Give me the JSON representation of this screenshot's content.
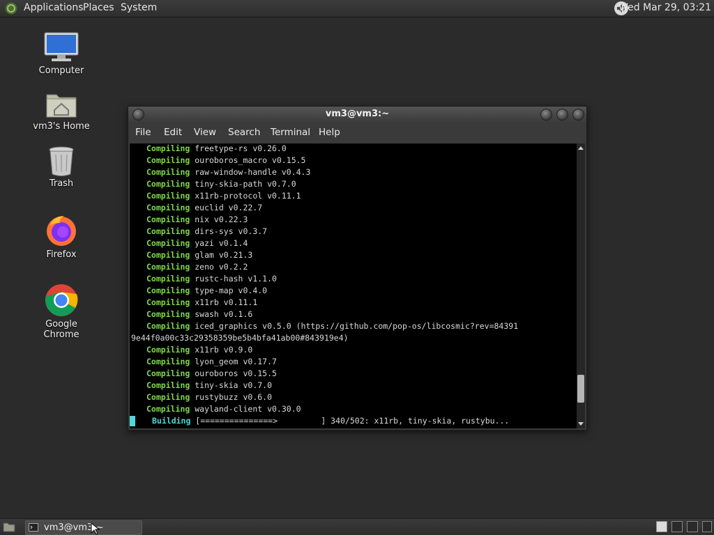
{
  "top_panel": {
    "menus": [
      "Applications",
      "Places",
      "System"
    ],
    "clock": "Wed Mar 29, 03:21",
    "icons": [
      "mate-menu-icon",
      "volume-icon"
    ]
  },
  "desktop": {
    "icons": [
      {
        "label": "Computer",
        "icon": "computer-icon"
      },
      {
        "label": "vm3's Home",
        "icon": "home-folder-icon"
      },
      {
        "label": "Trash",
        "icon": "trash-icon"
      },
      {
        "label": "Firefox",
        "icon": "firefox-icon"
      },
      {
        "label": "Google Chrome",
        "icon": "chrome-icon"
      }
    ]
  },
  "terminal": {
    "title": "vm3@vm3:~",
    "menu": [
      "File",
      "Edit",
      "View",
      "Search",
      "Terminal",
      "Help"
    ],
    "lines": [
      {
        "kw": "Compiling",
        "text": " freetype-rs v0.26.0"
      },
      {
        "kw": "Compiling",
        "text": " ouroboros_macro v0.15.5"
      },
      {
        "kw": "Compiling",
        "text": " raw-window-handle v0.4.3"
      },
      {
        "kw": "Compiling",
        "text": " tiny-skia-path v0.7.0"
      },
      {
        "kw": "Compiling",
        "text": " x11rb-protocol v0.11.1"
      },
      {
        "kw": "Compiling",
        "text": " euclid v0.22.7"
      },
      {
        "kw": "Compiling",
        "text": " nix v0.22.3"
      },
      {
        "kw": "Compiling",
        "text": " dirs-sys v0.3.7"
      },
      {
        "kw": "Compiling",
        "text": " yazi v0.1.4"
      },
      {
        "kw": "Compiling",
        "text": " glam v0.21.3"
      },
      {
        "kw": "Compiling",
        "text": " zeno v0.2.2"
      },
      {
        "kw": "Compiling",
        "text": " rustc-hash v1.1.0"
      },
      {
        "kw": "Compiling",
        "text": " type-map v0.4.0"
      },
      {
        "kw": "Compiling",
        "text": " x11rb v0.11.1"
      },
      {
        "kw": "Compiling",
        "text": " swash v0.1.6"
      },
      {
        "kw": "Compiling",
        "text": " iced_graphics v0.5.0 (https://github.com/pop-os/libcosmic?rev=84391"
      },
      {
        "kw": "",
        "text": "9e44f0a00c33c29358359be5b4bfa41ab00#843919e4)"
      },
      {
        "kw": "Compiling",
        "text": " x11rb v0.9.0"
      },
      {
        "kw": "Compiling",
        "text": " lyon_geom v0.17.7"
      },
      {
        "kw": "Compiling",
        "text": " ouroboros v0.15.5"
      },
      {
        "kw": "Compiling",
        "text": " tiny-skia v0.7.0"
      },
      {
        "kw": "Compiling",
        "text": " rustybuzz v0.6.0"
      },
      {
        "kw": "Compiling",
        "text": " wayland-client v0.30.0"
      }
    ],
    "status": {
      "kw": "Building",
      "text": " [===============>         ] 340/502: x11rb, tiny-skia, rustybu..."
    },
    "scroll_position": 0.93
  },
  "bottom_panel": {
    "task_label": "vm3@vm3:~",
    "icons": [
      "show-desktop-icon",
      "terminal-icon"
    ]
  },
  "colors": {
    "compiling": "#7fd94a",
    "building": "#52d6d6",
    "desktop_bg": "#2b2b2b"
  }
}
